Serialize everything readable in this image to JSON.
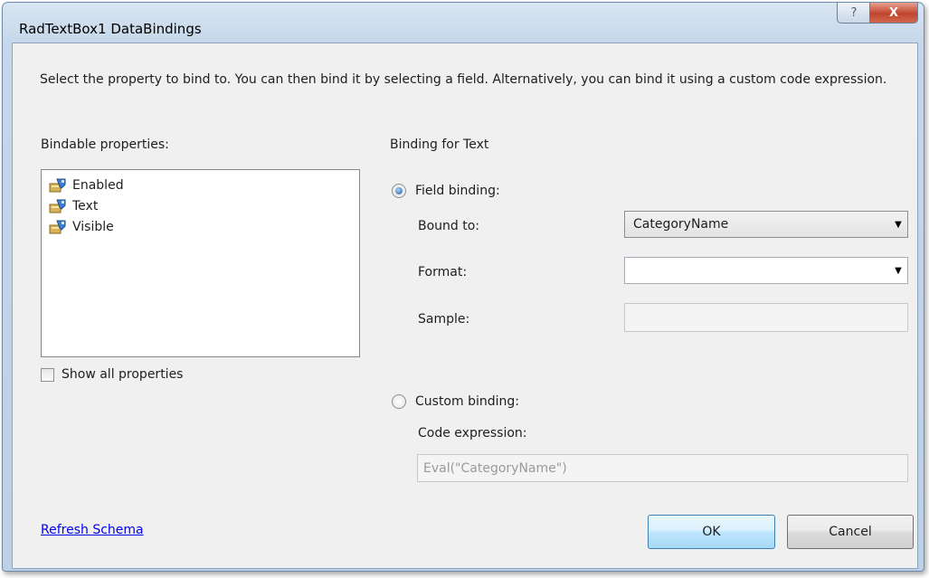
{
  "window": {
    "title": "RadTextBox1 DataBindings",
    "help_glyph": "?",
    "close_glyph": "X"
  },
  "description": "Select the property to bind to. You can then bind it by selecting a field. Alternatively, you can bind it using a custom code expression.",
  "properties": {
    "label": "Bindable properties:",
    "items": [
      {
        "label": "Enabled",
        "icon": "property-icon"
      },
      {
        "label": "Text",
        "icon": "property-icon"
      },
      {
        "label": "Visible",
        "icon": "property-icon"
      }
    ],
    "show_all_label": "Show all properties",
    "show_all_checked": false
  },
  "binding": {
    "header": "Binding for Text",
    "field_binding_label": "Field binding:",
    "field_binding_selected": true,
    "bound_to_label": "Bound to:",
    "bound_to_value": "CategoryName",
    "format_label": "Format:",
    "format_value": "",
    "sample_label": "Sample:",
    "sample_value": "",
    "custom_binding_label": "Custom binding:",
    "custom_binding_selected": false,
    "code_expression_label": "Code expression:",
    "code_expression_value": "Eval(\"CategoryName\")"
  },
  "footer": {
    "refresh_link": "Refresh Schema",
    "ok_label": "OK",
    "cancel_label": "Cancel"
  },
  "colors": {
    "link": "#0000ee",
    "accent": "#3c7fb1",
    "close_button": "#c1452d"
  }
}
